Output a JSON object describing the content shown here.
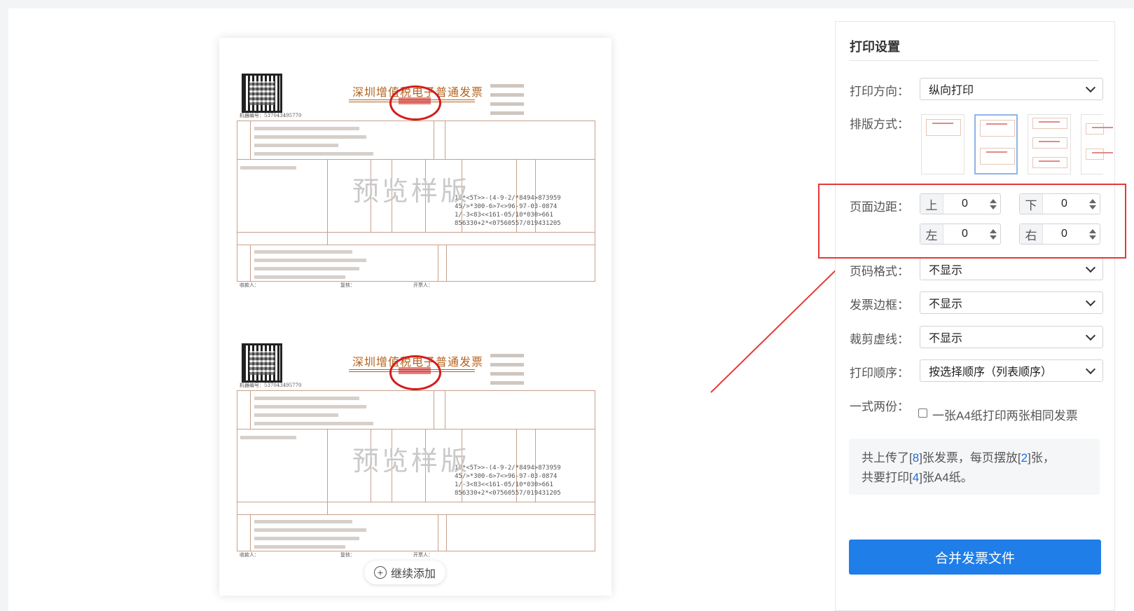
{
  "preview": {
    "invoice_title": "深圳增值税电子普通发票",
    "watermark": "预览样版",
    "machine_no": "机器编号：537043495770",
    "code_lines": [
      "10*<5T>>-(4-9-2/*8494>873959",
      "45/>*300-6>7<>96-97-03-0874",
      "1/-3<83<<161-05/10*030>661",
      "856330+2*<07560557/019431205"
    ],
    "footer_labels": [
      "收款人：",
      "复核：",
      "开票人："
    ],
    "add_more_label": "继续添加"
  },
  "settings": {
    "title": "打印设置",
    "orientation_label": "打印方向：",
    "orientation_value": "纵向打印",
    "layout_label": "排版方式：",
    "margin_label": "页面边距：",
    "margins": {
      "top_tag": "上",
      "top_value": "0",
      "bottom_tag": "下",
      "bottom_value": "0",
      "left_tag": "左",
      "left_value": "0",
      "right_tag": "右",
      "right_value": "0"
    },
    "page_number_label": "页码格式：",
    "page_number_value": "不显示",
    "border_label": "发票边框：",
    "border_value": "不显示",
    "crop_label": "裁剪虚线：",
    "crop_value": "不显示",
    "order_label": "打印顺序：",
    "order_value": "按选择顺序（列表顺序）",
    "duplicate_label": "一式两份：",
    "duplicate_option": "一张A4纸打印两张相同发票",
    "summary": {
      "part1": "共上传了[",
      "uploaded": "8",
      "part2": "]张发票，每页摆放[",
      "per_page": "2",
      "part3": "]张，",
      "part4": "共要打印[",
      "sheets": "4",
      "part5": "]张A4纸。"
    },
    "merge_button": "合并发票文件"
  },
  "colors": {
    "primary": "#1f7ee8",
    "highlight": "#e53935",
    "number": "#1e6fd9"
  }
}
